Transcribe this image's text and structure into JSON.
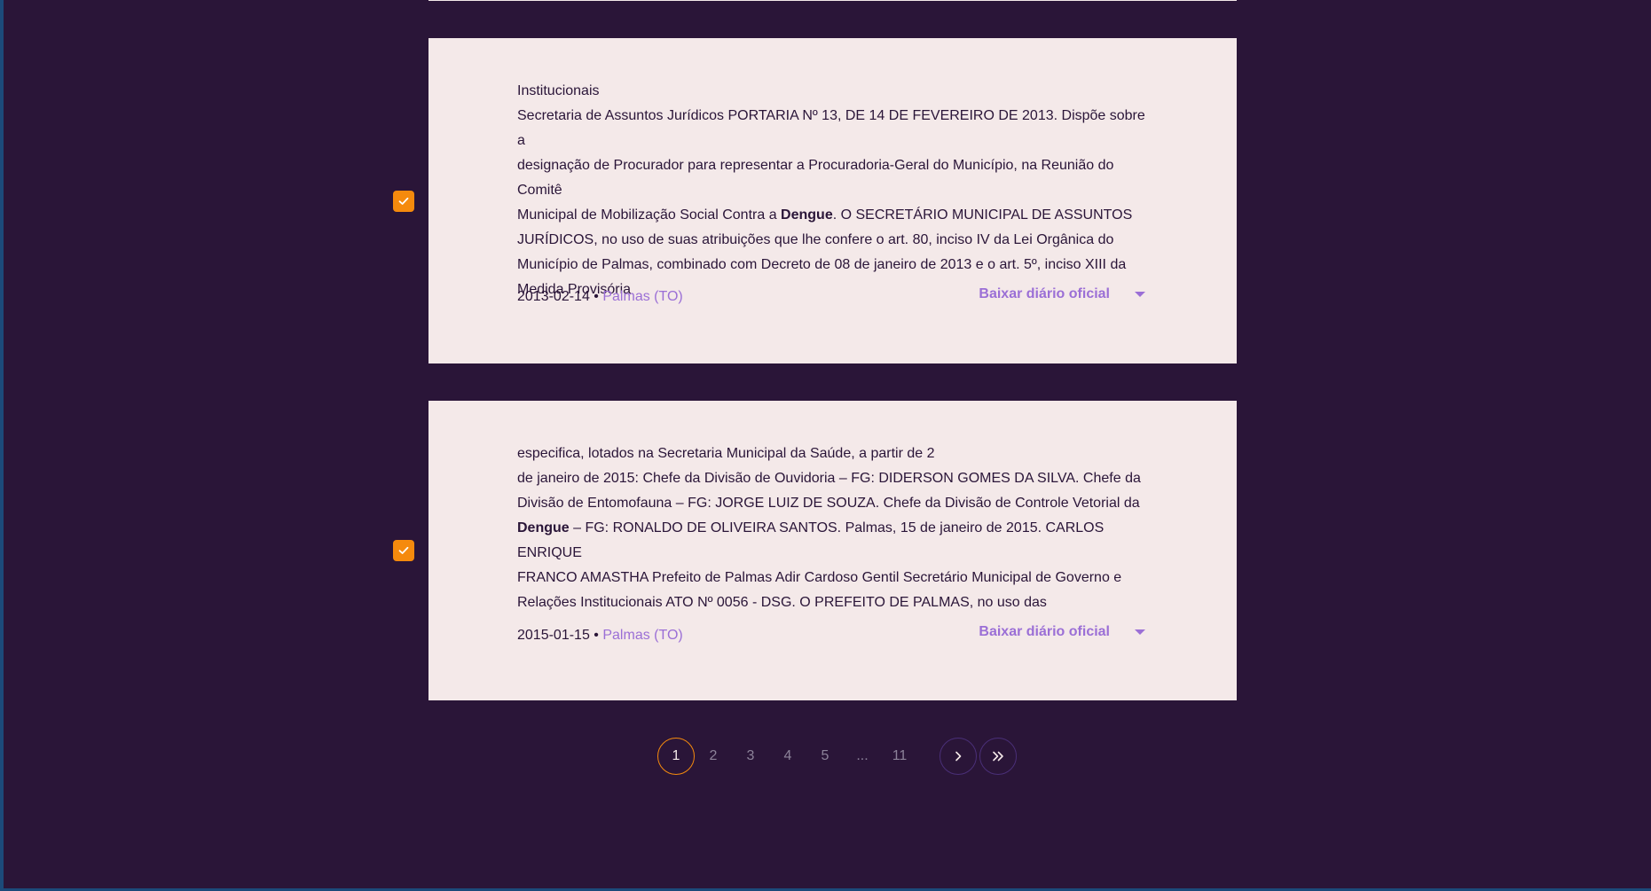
{
  "colors": {
    "background": "#2a1538",
    "card": "#f4e9e9",
    "accent": "#f58a0d",
    "link": "#9b6fd6"
  },
  "results": [
    {
      "checked": true,
      "excerpt_lines": [
        "Institucionais",
        "Secretaria de Assuntos Jurídicos PORTARIA Nº 13, DE 14 DE FEVEREIRO DE 2013. Dispõe sobre a",
        "designação de Procurador para representar a Procuradoria-Geral do Município, na Reunião do Comitê",
        "Municipal de Mobilização Social Contra a ",
        "Dengue",
        ". O SECRETÁRIO MUNICIPAL DE ASSUNTOS",
        "JURÍDICOS, no uso de suas atribuições que lhe confere o art. 80, inciso IV da Lei Orgânica do",
        "Município de Palmas, combinado com Decreto de 08 de janeiro de 2013 e o art. 5º, inciso XIII da",
        "Medida Provisória"
      ],
      "date": "2013-02-14",
      "separator": "•",
      "place": "Palmas (TO)",
      "download_label": "Baixar diário oficial"
    },
    {
      "checked": true,
      "excerpt_lines": [
        "especifica, lotados na Secretaria Municipal da Saúde, a partir de 2",
        "de janeiro de 2015: Chefe da Divisão de Ouvidoria – FG: DIDERSON GOMES DA SILVA. Chefe da",
        "Divisão de Entomofauna – FG: JORGE LUIZ DE SOUZA. Chefe da Divisão de Controle Vetorial da",
        "Dengue",
        " – FG: RONALDO DE OLIVEIRA SANTOS. Palmas, 15 de janeiro de 2015. CARLOS ENRIQUE",
        "FRANCO AMASTHA Prefeito de Palmas Adir Cardoso Gentil Secretário Municipal de Governo e",
        "Relações Institucionais ATO Nº 0056 - DSG. O PREFEITO DE PALMAS, no uso das"
      ],
      "date": "2015-01-15",
      "separator": "•",
      "place": "Palmas (TO)",
      "download_label": "Baixar diário oficial"
    }
  ],
  "pagination": {
    "pages": [
      "1",
      "2",
      "3",
      "4",
      "5",
      "...",
      "11"
    ],
    "current": "1",
    "next_icon": "chevron-right-icon",
    "last_icon": "double-chevron-right-icon"
  }
}
